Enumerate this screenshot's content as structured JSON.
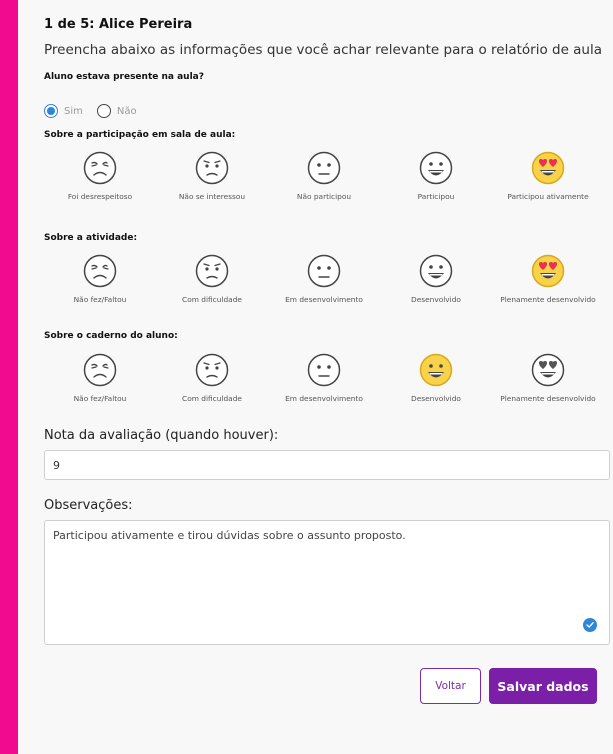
{
  "header": {
    "student_title": "1 de 5: Alice Pereira",
    "instructions": "Preencha abaixo as informações que você achar relevante para o relatório de aula"
  },
  "presence": {
    "question": "Aluno estava presente na aula?",
    "options": [
      "Sim",
      "Não"
    ],
    "selected": "Sim"
  },
  "participation": {
    "title": "Sobre a participação em sala de aula:",
    "options": [
      "Foi desrespeitoso",
      "Não se interessou",
      "Não participou",
      "Participou",
      "Participou ativamente"
    ],
    "selected_index": 4
  },
  "activity": {
    "title": "Sobre a atividade:",
    "options": [
      "Não fez/Faltou",
      "Com dificuldade",
      "Em desenvolvimento",
      "Desenvolvido",
      "Plenamente desenvolvido"
    ],
    "selected_index": 4
  },
  "notebook": {
    "title": "Sobre o caderno do aluno:",
    "options": [
      "Não fez/Faltou",
      "Com dificuldade",
      "Em desenvolvimento",
      "Desenvolvido",
      "Plenamente desenvolvido"
    ],
    "selected_index": 3
  },
  "grade": {
    "label": "Nota da avaliação (quando houver):",
    "value": "9"
  },
  "observations": {
    "label": "Observações:",
    "value": "Participou ativamente e tirou dúvidas sobre o assunto proposto."
  },
  "buttons": {
    "back": "Voltar",
    "save": "Salvar dados"
  },
  "colors": {
    "accent_pink": "#f10b8f",
    "primary_purple": "#7b1fa9",
    "radio_blue": "#2f86d6",
    "emoji_yellow": "#f7d24a",
    "heart_red": "#e83350"
  }
}
